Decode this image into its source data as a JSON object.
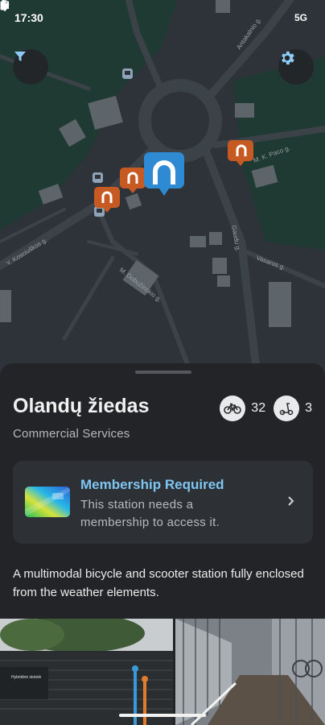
{
  "status_bar": {
    "time": "17:30",
    "network": "5G"
  },
  "map": {
    "street_labels": [
      "Y. Kosciuškos g.",
      "M. Dobužinskio g.",
      "Gaudu g.",
      "Vasaros g.",
      "Antakalnio g.",
      "M. K. Paco g."
    ],
    "colors": {
      "land": "#2d3338",
      "park": "#1f3a32",
      "road": "#3b4248",
      "building": "#5d646a",
      "selected_marker": "#2f8ad4",
      "station_marker": "#c75a22"
    },
    "icons": {
      "filter": "filter-icon",
      "settings": "gear-icon",
      "selected_station": "station-marker-icon",
      "station": "station-marker-icon"
    }
  },
  "station": {
    "name": "Olandų žiedas",
    "category": "Commercial Services",
    "bike_count": "32",
    "scooter_count": "3",
    "bike_icon": "bicycle-icon",
    "scooter_icon": "scooter-icon"
  },
  "membership": {
    "title": "Membership Required",
    "description": "This station needs a membership to access it.",
    "icon": "membership-card-icon",
    "chevron": "chevron-right-icon"
  },
  "description": "A multimodal bicycle and scooter station fully enclosed from the weather elements.",
  "photos": {
    "sign_text": "Hybridinė stotelė"
  }
}
